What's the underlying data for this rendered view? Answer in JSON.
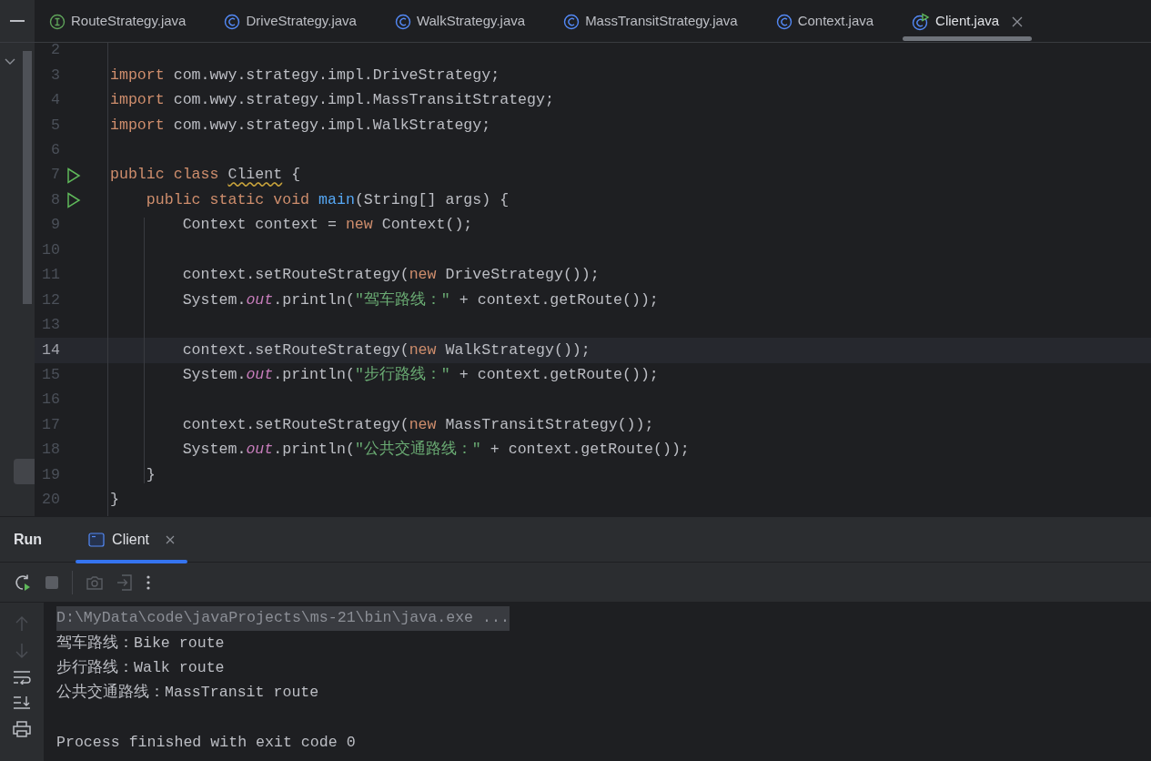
{
  "tabs": [
    {
      "label": "RouteStrategy.java",
      "kind": "interface",
      "selected": false
    },
    {
      "label": "DriveStrategy.java",
      "kind": "class",
      "selected": false
    },
    {
      "label": "WalkStrategy.java",
      "kind": "class",
      "selected": false
    },
    {
      "label": "MassTransitStrategy.java",
      "kind": "class",
      "selected": false
    },
    {
      "label": "Context.java",
      "kind": "class",
      "selected": false
    },
    {
      "label": "Client.java",
      "kind": "runnable",
      "selected": true
    }
  ],
  "editor": {
    "lines": [
      {
        "number": "2",
        "current": false,
        "run_marker": false
      },
      {
        "number": "3",
        "current": false,
        "run_marker": false,
        "tokens": [
          {
            "text": "import",
            "kind": "keyword"
          },
          {
            "text": " com.wwy.strategy.impl.DriveStrategy;",
            "kind": "plain"
          }
        ]
      },
      {
        "number": "4",
        "current": false,
        "run_marker": false,
        "tokens": [
          {
            "text": "import",
            "kind": "keyword"
          },
          {
            "text": " com.wwy.strategy.impl.MassTransitStrategy;",
            "kind": "plain"
          }
        ]
      },
      {
        "number": "5",
        "current": false,
        "run_marker": false,
        "tokens": [
          {
            "text": "import",
            "kind": "keyword"
          },
          {
            "text": " com.wwy.strategy.impl.WalkStrategy;",
            "kind": "plain"
          }
        ]
      },
      {
        "number": "6",
        "current": false,
        "run_marker": false
      },
      {
        "number": "7",
        "current": false,
        "run_marker": true,
        "tokens": [
          {
            "text": "public class ",
            "kind": "keyword"
          },
          {
            "text": "Client",
            "kind": "warning"
          },
          {
            "text": " {",
            "kind": "plain"
          }
        ]
      },
      {
        "number": "8",
        "current": false,
        "run_marker": true,
        "tokens": [
          {
            "text": "    public static void ",
            "kind": "keyword"
          },
          {
            "text": "main",
            "kind": "method"
          },
          {
            "text": "(String[] args) {",
            "kind": "plain"
          }
        ]
      },
      {
        "number": "9",
        "current": false,
        "run_marker": false,
        "tokens": [
          {
            "text": "        Context context = ",
            "kind": "plain"
          },
          {
            "text": "new",
            "kind": "keyword"
          },
          {
            "text": " Context();",
            "kind": "plain"
          }
        ]
      },
      {
        "number": "10",
        "current": false,
        "run_marker": false
      },
      {
        "number": "11",
        "current": false,
        "run_marker": false,
        "tokens": [
          {
            "text": "        context.setRouteStrategy(",
            "kind": "plain"
          },
          {
            "text": "new",
            "kind": "keyword"
          },
          {
            "text": " DriveStrategy());",
            "kind": "plain"
          }
        ]
      },
      {
        "number": "12",
        "current": false,
        "run_marker": false,
        "tokens": [
          {
            "text": "        System.",
            "kind": "plain"
          },
          {
            "text": "out",
            "kind": "field"
          },
          {
            "text": ".println(",
            "kind": "plain"
          },
          {
            "text": "\"驾车路线：\"",
            "kind": "string"
          },
          {
            "text": " + context.getRoute());",
            "kind": "plain"
          }
        ]
      },
      {
        "number": "13",
        "current": false,
        "run_marker": false
      },
      {
        "number": "14",
        "current": true,
        "run_marker": false,
        "tokens": [
          {
            "text": "        context.setRouteStrategy(",
            "kind": "plain"
          },
          {
            "text": "new",
            "kind": "keyword"
          },
          {
            "text": " WalkStrategy());",
            "kind": "plain"
          }
        ]
      },
      {
        "number": "15",
        "current": false,
        "run_marker": false,
        "tokens": [
          {
            "text": "        System.",
            "kind": "plain"
          },
          {
            "text": "out",
            "kind": "field"
          },
          {
            "text": ".println(",
            "kind": "plain"
          },
          {
            "text": "\"步行路线：\"",
            "kind": "string"
          },
          {
            "text": " + context.getRoute());",
            "kind": "plain"
          }
        ]
      },
      {
        "number": "16",
        "current": false,
        "run_marker": false
      },
      {
        "number": "17",
        "current": false,
        "run_marker": false,
        "tokens": [
          {
            "text": "        context.setRouteStrategy(",
            "kind": "plain"
          },
          {
            "text": "new",
            "kind": "keyword"
          },
          {
            "text": " MassTransitStrategy());",
            "kind": "plain"
          }
        ]
      },
      {
        "number": "18",
        "current": false,
        "run_marker": false,
        "tokens": [
          {
            "text": "        System.",
            "kind": "plain"
          },
          {
            "text": "out",
            "kind": "field"
          },
          {
            "text": ".println(",
            "kind": "plain"
          },
          {
            "text": "\"公共交通路线：\"",
            "kind": "string"
          },
          {
            "text": " + context.getRoute());",
            "kind": "plain"
          }
        ]
      },
      {
        "number": "19",
        "current": false,
        "run_marker": false,
        "tokens": [
          {
            "text": "    }",
            "kind": "plain"
          }
        ]
      },
      {
        "number": "20",
        "current": false,
        "run_marker": false,
        "tokens": [
          {
            "text": "}",
            "kind": "plain"
          }
        ]
      }
    ]
  },
  "run_panel": {
    "title": "Run",
    "tabs": [
      {
        "label": "Client",
        "selected": true
      }
    ],
    "console": [
      {
        "text": "D:\\MyData\\code\\javaProjects\\ms-21\\bin\\java.exe ...",
        "kind": "command"
      },
      {
        "text": "驾车路线：Bike route",
        "kind": "output"
      },
      {
        "text": "步行路线：Walk route",
        "kind": "output"
      },
      {
        "text": "公共交通路线：MassTransit route",
        "kind": "output"
      },
      {
        "text": "Process finished with exit code 0",
        "kind": "exit"
      }
    ]
  }
}
